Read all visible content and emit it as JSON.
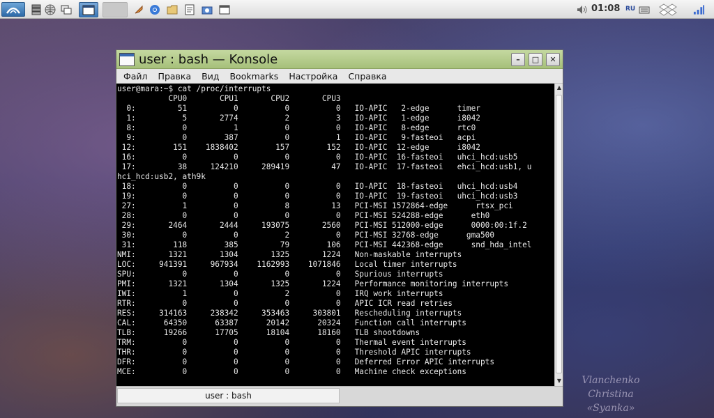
{
  "panel": {
    "clock": "01:08",
    "keyboard_layout": "RU",
    "launchers": [
      "menu-icon",
      "files-icon",
      "browser-icon",
      "windows-icon"
    ],
    "tray_icons": [
      "speaker-icon",
      "keyboard-icon",
      "dropbox-icon",
      "network-signal-icon"
    ]
  },
  "window": {
    "title": "user : bash — Konsole",
    "menu": [
      "Файл",
      "Правка",
      "Вид",
      "Bookmarks",
      "Настройка",
      "Справка"
    ],
    "buttons": {
      "minimize": "–",
      "maximize": "□",
      "close": "✕"
    },
    "tab_label": "user : bash"
  },
  "terminal": {
    "lines": [
      "user@mara:~$ cat /proc/interrupts",
      "           CPU0       CPU1       CPU2       CPU3",
      "  0:         51          0          0          0   IO-APIC   2-edge      timer",
      "  1:          5       2774          2          3   IO-APIC   1-edge      i8042",
      "  8:          0          1          0          0   IO-APIC   8-edge      rtc0",
      "  9:          0        387          0          1   IO-APIC   9-fasteoi   acpi",
      " 12:        151    1838402        157        152   IO-APIC  12-edge      i8042",
      " 16:          0          0          0          0   IO-APIC  16-fasteoi   uhci_hcd:usb5",
      " 17:         38     124210     289419         47   IO-APIC  17-fasteoi   ehci_hcd:usb1, u",
      "hci_hcd:usb2, ath9k",
      " 18:          0          0          0          0   IO-APIC  18-fasteoi   uhci_hcd:usb4",
      " 19:          0          0          0          0   IO-APIC  19-fasteoi   uhci_hcd:usb3",
      " 27:          1          0          8         13   PCI-MSI 1572864-edge      rtsx_pci",
      " 28:          0          0          0          0   PCI-MSI 524288-edge      eth0",
      " 29:       2464       2444     193075       2560   PCI-MSI 512000-edge      0000:00:1f.2",
      " 30:          0          0          2          0   PCI-MSI 32768-edge      gma500",
      " 31:        118        385         79        106   PCI-MSI 442368-edge      snd_hda_intel",
      "NMI:       1321       1304       1325       1224   Non-maskable interrupts",
      "LOC:     941391     967934    1162993    1071846   Local timer interrupts",
      "SPU:          0          0          0          0   Spurious interrupts",
      "PMI:       1321       1304       1325       1224   Performance monitoring interrupts",
      "IWI:          1          0          2          0   IRQ work interrupts",
      "RTR:          0          0          0          0   APIC ICR read retries",
      "RES:     314163     238342     353463     303801   Rescheduling interrupts",
      "CAL:      64350      63387      20142      20324   Function call interrupts",
      "TLB:      19266      17705      18104      18160   TLB shootdowns",
      "TRM:          0          0          0          0   Thermal event interrupts",
      "THR:          0          0          0          0   Threshold APIC interrupts",
      "DFR:          0          0          0          0   Deferred Error APIC interrupts",
      "MCE:          0          0          0          0   Machine check exceptions"
    ]
  },
  "wallpaper": {
    "signature_line1": "Vlanchenko Christina",
    "signature_line2": "«Syanka»"
  },
  "colors": {
    "titlebar": "#b4cc8c",
    "terminal_bg": "#000000",
    "terminal_fg": "#e8e8e8",
    "start_button": "#3a78b8"
  }
}
